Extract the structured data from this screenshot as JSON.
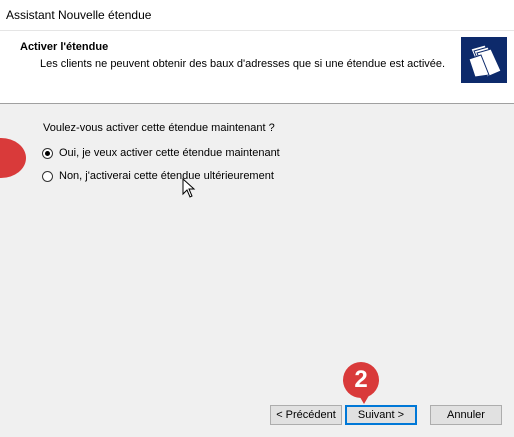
{
  "window": {
    "title": "Assistant Nouvelle étendue"
  },
  "header": {
    "title": "Activer l'étendue",
    "subtitle": "Les clients ne peuvent obtenir des baux d'adresses que si une étendue est activée.",
    "icon": "folders-icon"
  },
  "body": {
    "question": "Voulez-vous activer cette étendue maintenant ?",
    "options": [
      {
        "label": "Oui, je veux activer cette étendue maintenant",
        "checked": true
      },
      {
        "label": "Non, j'activerai cette étendue ultérieurement",
        "checked": false
      }
    ]
  },
  "buttons": {
    "prev": "< Précédent",
    "next": "Suivant >",
    "cancel": "Annuler"
  },
  "annotations": {
    "step2": "2",
    "color": "#d93a3a"
  }
}
